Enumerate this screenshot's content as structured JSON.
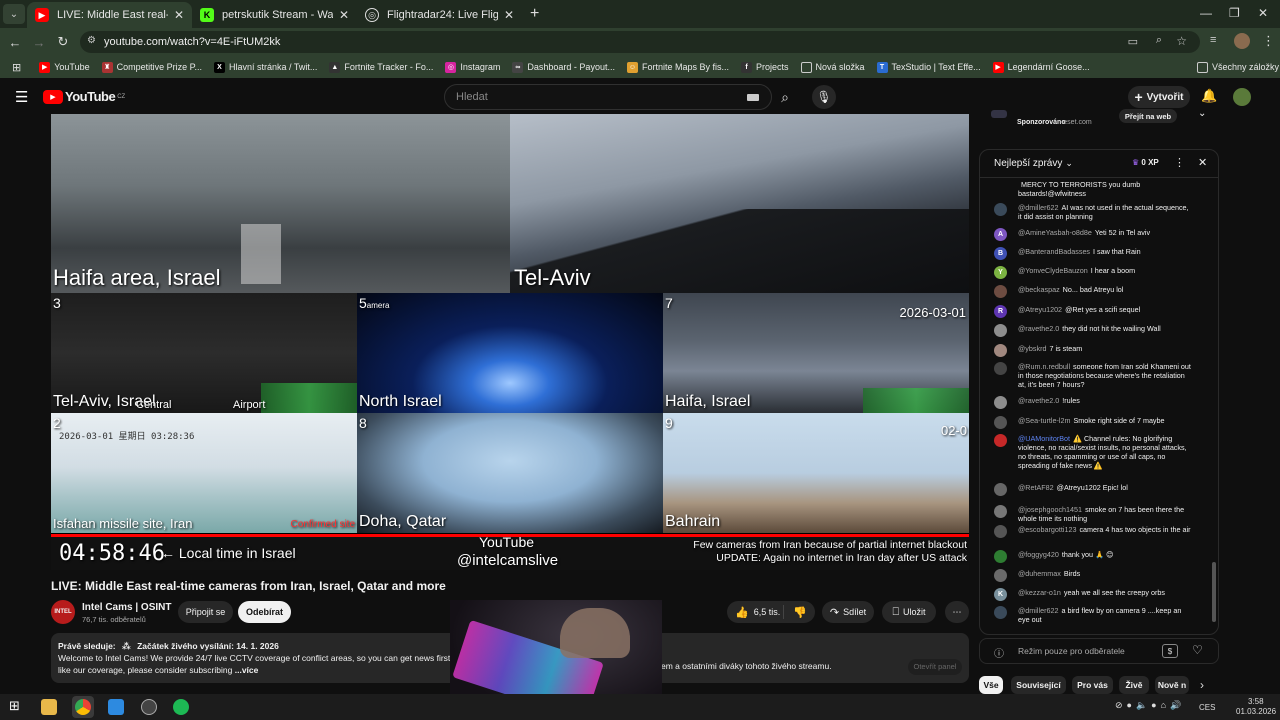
{
  "browser": {
    "tabs": [
      {
        "label": "LIVE: Middle East real-time cams",
        "icon": "youtube-icon",
        "active": true
      },
      {
        "label": "petrskutik Stream - Watch Live",
        "icon": "kick-icon",
        "active": false
      },
      {
        "label": "Flightradar24: Live Flight Track",
        "icon": "flightradar-icon",
        "active": false
      }
    ],
    "url": "youtube.com/watch?v=4E-iFtUM2kk",
    "bookmarks": [
      "YouTube",
      "Competitive Prize P...",
      "Hlavní stránka / Twit...",
      "Fortnite Tracker - Fo...",
      "Instagram",
      "Dashboard - Payout...",
      "Fortnite Maps By fis...",
      "Projects",
      "Nová složka",
      "TexStudio | Text Effe...",
      "Legendární Goose..."
    ],
    "bookmarks_folder": "Všechny záložky"
  },
  "youtube": {
    "logo_text": "YouTube",
    "logo_region": "CZ",
    "search_placeholder": "Hledat",
    "create_label": "Vytvořit"
  },
  "player": {
    "cameras": [
      {
        "num": "",
        "label": "Haifa area, Israel"
      },
      {
        "num": "",
        "label": "Tel-Aviv"
      },
      {
        "num": "3",
        "label": "Tel-Aviv, Israel",
        "sub1": "Central",
        "sub2": "Airport"
      },
      {
        "num": "5",
        "label": "North Israel",
        "extra": "amera"
      },
      {
        "num": "7",
        "label": "Haifa, Israel",
        "date": "2026-03-01"
      },
      {
        "num": "2",
        "label": "Isfahan missile site, Iran",
        "stamp": "2026-03-01 星期日 03:28:36",
        "tag": "Confirmed site"
      },
      {
        "num": "8",
        "label": "Doha, Qatar"
      },
      {
        "num": "9",
        "label": "Bahrain",
        "date": "02-0"
      }
    ],
    "clock": "04:58:46",
    "clock_note": "← Local time in Israel",
    "brand_line1": "YouTube",
    "brand_line2": "@intelcamslive",
    "notice_line1": "Few cameras from Iran because of partial internet blackout",
    "notice_line2": "UPDATE: Again no internet in Iran day after US attack"
  },
  "video": {
    "title": "LIVE: Middle East real-time cameras from Iran, Israel, Qatar and more",
    "channel": "Intel Cams | OSINT",
    "subscribers": "76,7 tis. odběratelů",
    "join_label": "Připojit se",
    "subscribe_label": "Odebírat",
    "likes": "6,5 tis.",
    "share_label": "Sdílet",
    "save_label": "Uložit",
    "desc_watching": "Právě sleduje:",
    "desc_started": "Začátek živého vysílání: 14. 1. 2026",
    "desc_line1": "Welcome to Intel Cams! We provide 24/7 live CCTV coverage of conflict areas, so you can get news first-h",
    "desc_line1b": "em a ostatními diváky tohoto živého streamu.",
    "desc_line2": "like our coverage, please consider subscribing",
    "desc_more": "...více",
    "open_panel": "Otevřít panel"
  },
  "sponsor": {
    "label": "Sponzorováno",
    "domain": "eset.com",
    "button": "Přejít na web"
  },
  "chat": {
    "header": "Nejlepší zprávy",
    "xp": "0 XP",
    "messages": [
      {
        "author": "",
        "text": "MERCY TO TERRORISTS you dumb bastards!@wfwitness",
        "color": "#555"
      },
      {
        "author": "@dmiller622",
        "text": "AI was not used in the actual sequence, it did assist on planning",
        "color": "#3a4a5a"
      },
      {
        "author": "@AmineYasbah-o8d8e",
        "text": "Yeti 52 in Tel aviv",
        "color": "#7e57c2",
        "initial": "A"
      },
      {
        "author": "@BanterandBadasses",
        "text": "I saw that Rain",
        "color": "#3f51b5",
        "initial": "B"
      },
      {
        "author": "@YonveClydeBauzon",
        "text": "I hear a boom",
        "color": "#7cb342",
        "initial": "Y"
      },
      {
        "author": "@beckaspaz",
        "text": "No... bad Atreyu lol",
        "color": "#6d4c41"
      },
      {
        "author": "@Atreyu1202",
        "text": "@Ret yes a scifi sequel",
        "color": "#5e35b1",
        "initial": "R"
      },
      {
        "author": "@ravethe2.0",
        "text": "they did not hit the wailing Wall",
        "color": "#8d8d8d"
      },
      {
        "author": "@ybskrd",
        "text": "7 is steam",
        "color": "#a1887f"
      },
      {
        "author": "@Rum.n.redbull",
        "text": "someone from Iran sold Khameni out in those negotiations because where's the retaliation at, it's been 7 hours?",
        "color": "#444"
      },
      {
        "author": "@ravethe2.0",
        "text": "!rules",
        "color": "#8d8d8d"
      },
      {
        "author": "@Sea-turtle-l2m",
        "text": "Smoke right side of 7 maybe",
        "color": "#555"
      },
      {
        "author": "@UAMonitorBot",
        "text": "⚠️ Channel rules: No glorifying violence, no racial/sexist insults, no personal attacks, no threats, no spamming or use of all caps, no spreading of fake news ⚠️",
        "color": "#c62828",
        "mod": true
      },
      {
        "author": "@RetAF82",
        "text": "@Atreyu1202 Epic! lol",
        "color": "#666"
      },
      {
        "author": "@josephgooch1451",
        "text": "smoke on 7 has been there the whole time its nothing",
        "color": "#777"
      },
      {
        "author": "@escobargotti123",
        "text": "camera 4 has two objects in the air",
        "color": "#555"
      },
      {
        "author": "@foggyg420",
        "text": "thank you 🙏 😊",
        "color": "#2e7d32"
      },
      {
        "author": "@duhemmax",
        "text": "Birds",
        "color": "#6a6a6a"
      },
      {
        "author": "@kezzar-o1n",
        "text": "yeah we all see the creepy orbs",
        "color": "#78909c",
        "initial": "K"
      },
      {
        "author": "@dmiller622",
        "text": "a bird flew by on camera 9 ....keep an eye out",
        "color": "#3a4a5a"
      }
    ],
    "footer": "Režim pouze pro odběratele"
  },
  "chips": [
    "Vše",
    "Související",
    "Pro vás",
    "Živě",
    "Nově n"
  ],
  "taskbar": {
    "lang": "CES",
    "time": "3:58",
    "date": "01.03.2026"
  }
}
